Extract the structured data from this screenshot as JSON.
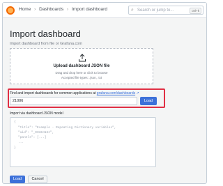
{
  "topbar": {
    "breadcrumb": [
      "Home",
      "Dashboards",
      "Import dashboard"
    ],
    "separator": "›",
    "search_placeholder": "Search or jump to...",
    "shortcut": "ctrl+k"
  },
  "page": {
    "title": "Import dashboard",
    "subtitle": "Import dashboard from file or Grafana.com"
  },
  "upload": {
    "title": "Upload dashboard JSON file",
    "hint": "Drag and drop here or click to browse",
    "types": "Accepted file types: .json, .txt"
  },
  "grafana_com": {
    "label": "Find and import dashboards for common applications at",
    "link": "grafana.com/dashboards",
    "input_value": "21006",
    "load_label": "Load"
  },
  "json_model": {
    "label": "Import via dashboard JSON model",
    "lines": [
      "{",
      "\"title\": \"Example - Repeating Dictionary variables\",",
      "\"uid\": \"_0HnEoN4z\",",
      "\"panels\": [...]",
      "...",
      "}"
    ]
  },
  "actions": {
    "load_label": "Load",
    "cancel_label": "Cancel"
  },
  "colors": {
    "primary": "#3d71d9",
    "highlight": "#e02f44",
    "link": "#3871dc"
  },
  "icons": {
    "logo": "grafana-logo",
    "search": "search-icon",
    "upload": "upload-icon",
    "external_link": "external-link-icon"
  }
}
